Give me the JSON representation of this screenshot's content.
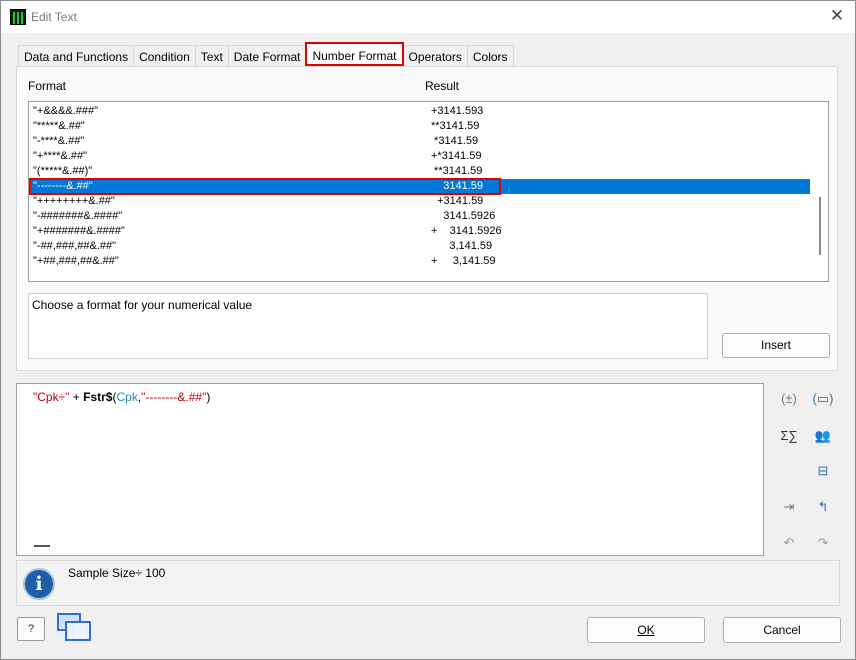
{
  "window": {
    "title": "Edit Text",
    "close_glyph": "✕"
  },
  "tabs": [
    {
      "label": "Data and Functions",
      "active": false
    },
    {
      "label": "Condition",
      "active": false
    },
    {
      "label": "Text",
      "active": false
    },
    {
      "label": "Date Format",
      "active": false
    },
    {
      "label": "Number Format",
      "active": true
    },
    {
      "label": "Operators",
      "active": false
    },
    {
      "label": "Colors",
      "active": false
    }
  ],
  "list": {
    "col_format": "Format",
    "col_result": "Result",
    "selected_index": 5,
    "rows": [
      {
        "format": "\"+&&&&.###\"",
        "result": "+3141.593"
      },
      {
        "format": "\"*****&.##\"",
        "result": "**3141.59"
      },
      {
        "format": "\"-****&.##\"",
        "result": " *3141.59"
      },
      {
        "format": "\"+****&.##\"",
        "result": "+*3141.59"
      },
      {
        "format": "\"(*****&.##)\"",
        "result": " **3141.59"
      },
      {
        "format": "\"--------&.##\"",
        "result": "    3141.59"
      },
      {
        "format": "\"++++++++&.##\"",
        "result": "  +3141.59"
      },
      {
        "format": "\"-#######&.####\"",
        "result": "    3141.5926"
      },
      {
        "format": "\"+#######&.####\"",
        "result": "+    3141.5926"
      },
      {
        "format": "\"-##,###,##&.##\"",
        "result": "      3,141.59"
      },
      {
        "format": "\"+##,###,##&.##\"",
        "result": "+     3,141.59"
      }
    ]
  },
  "description": "Choose a format for your numerical value",
  "insert_label": "Insert",
  "editor": {
    "str1": "\"Cpk÷\"",
    "plus": " + ",
    "func": "Fstr$",
    "open": "(",
    "var": "Cpk",
    "comma": ",",
    "str2": "\"--------&.##\"",
    "close": ")"
  },
  "side_tools": [
    {
      "name": "brackets-icon",
      "glyph": "(±)"
    },
    {
      "name": "field-icon",
      "glyph": "(▭)"
    },
    {
      "name": "sigma-icon",
      "glyph": "Σ∑"
    },
    {
      "name": "users-icon",
      "glyph": "👥"
    },
    {
      "name": "insert-field-icon",
      "glyph": "⊟"
    },
    {
      "name": "indent-icon",
      "glyph": "⇥"
    },
    {
      "name": "outdent-icon",
      "glyph": "↰"
    },
    {
      "name": "undo-icon",
      "glyph": "↶"
    },
    {
      "name": "redo-icon",
      "glyph": "↷"
    }
  ],
  "status": {
    "text": "Sample Size÷ 100",
    "icon": "i"
  },
  "buttons": {
    "help_glyph": "?",
    "ok": "OK",
    "cancel": "Cancel"
  },
  "colors": {
    "accent": "#0078d7",
    "highlight": "#e00000"
  }
}
